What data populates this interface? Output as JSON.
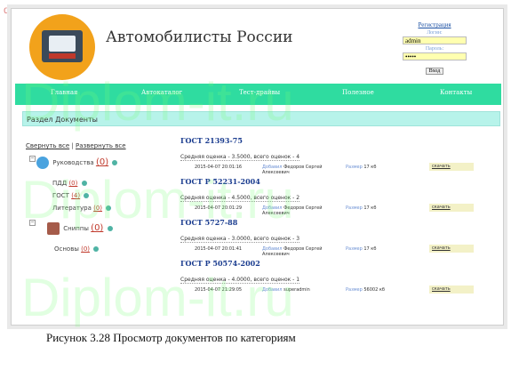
{
  "watermark": {
    "corner_text": "diplom-it.ru",
    "big_text": "Diplom-it.ru"
  },
  "header": {
    "title": "Автомобилисты России"
  },
  "login": {
    "register_link": "Регистрация",
    "login_label": "Логин:",
    "login_value": "admin",
    "password_label": "Пароль:",
    "password_value": "•••••",
    "submit_label": "Вход"
  },
  "nav": {
    "items": [
      "Главная",
      "Автокаталог",
      "Тест-драйвы",
      "Полезное",
      "Контакты"
    ]
  },
  "section": {
    "title": "Раздел Документы"
  },
  "tree": {
    "collapse_all": "Свернуть все",
    "separator": "|",
    "expand_all": "Развернуть все",
    "nodes": [
      {
        "label": "Руководства",
        "count": "(0)"
      },
      {
        "label": "ПДД",
        "count": "(0)"
      },
      {
        "label": "ГОСТ",
        "count": "(4)"
      },
      {
        "label": "Литература",
        "count": "(0)"
      },
      {
        "label": "Сниппы",
        "count": "(0)"
      },
      {
        "label": "Основы",
        "count": "(0)"
      }
    ]
  },
  "documents": [
    {
      "title": "ГОСТ 21393-75",
      "rating": "Средняя оценка - 3.5000, всего оценок - 4",
      "date": "2015-04-07 20:01:16",
      "added_label": "Добавил",
      "author": "Федоров Сергей Алексеевич",
      "size_label": "Размер",
      "size": "17 кб",
      "download": "скачать"
    },
    {
      "title": "ГОСТ Р 52231-2004",
      "rating": "Средняя оценка - 4.5000, всего оценок - 2",
      "date": "2015-04-07 20:01:29",
      "added_label": "Добавил",
      "author": "Федоров Сергей Алексеевич",
      "size_label": "Размер",
      "size": "17 кб",
      "download": "скачать"
    },
    {
      "title": "ГОСТ 5727-88",
      "rating": "Средняя оценка - 3.0000, всего оценок - 3",
      "date": "2015-04-07 20:01:41",
      "added_label": "Добавил",
      "author": "Федоров Сергей Алексеевич",
      "size_label": "Размер",
      "size": "17 кб",
      "download": "скачать"
    },
    {
      "title": "ГОСТ Р 50574-2002",
      "rating": "Средняя оценка - 4.0000, всего оценок - 1",
      "date": "2015-04-07 21:29:05",
      "added_label": "Добавил",
      "author": "superadmin",
      "size_label": "Размер",
      "size": "56002 кб",
      "download": "скачать"
    }
  ],
  "caption": "Рисунок 3.28  Просмотр документов по категориям"
}
